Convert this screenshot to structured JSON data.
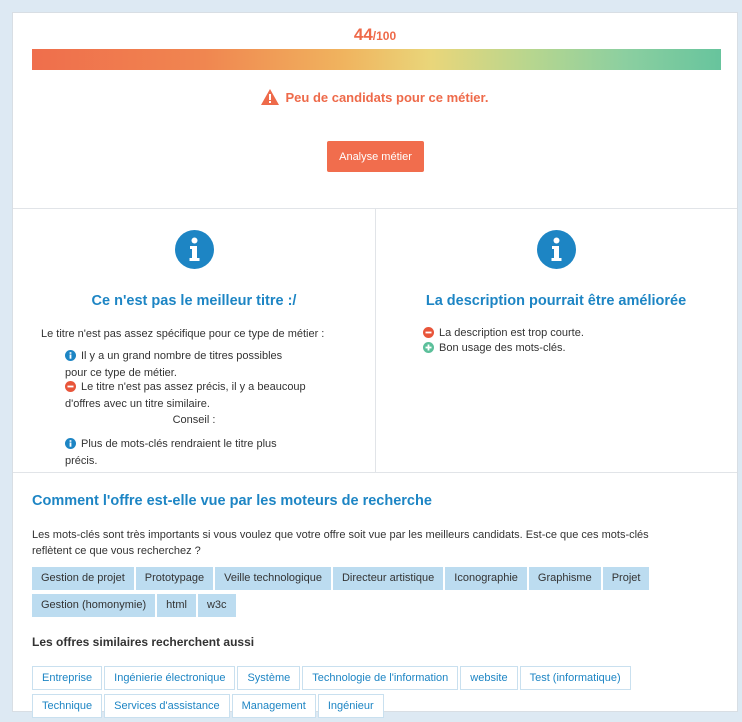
{
  "score": {
    "value": "44",
    "max": "/100",
    "fraction": 0.44
  },
  "warning": {
    "text": "Peu de candidats pour ce métier."
  },
  "analyse_button": "Analyse métier",
  "title_panel": {
    "heading": "Ce n'est pas le meilleur titre :/",
    "intro": "Le titre n'est pas assez spécifique pour ce type de métier :",
    "point1_line1": "Il y a un grand nombre de titres possibles",
    "point1_line2": "pour ce type de métier.",
    "point2_line1": "Le titre n'est pas assez précis, il y a beaucoup",
    "point2_line2": "d'offres avec un titre similaire.",
    "advice_label": "Conseil :",
    "point3_line1": "Plus de mots-clés rendraient le titre plus",
    "point3_line2": "précis."
  },
  "description_panel": {
    "heading": "La description pourrait être améliorée",
    "item1": "La description est trop courte.",
    "item2": "Bon usage des mots-clés."
  },
  "search": {
    "heading": "Comment l'offre est-elle vue par les moteurs de recherche",
    "desc_line1": "Les mots-clés sont très importants si vous voulez que votre offre soit vue par les meilleurs candidats. Est-ce que ces mots-clés",
    "desc_line2": "reflètent ce que vous recherchez ?",
    "keywords_row1": [
      "Gestion de projet",
      "Prototypage",
      "Veille technologique",
      "Directeur artistique",
      "Iconographie",
      "Graphisme",
      "Projet"
    ],
    "keywords_row2": [
      "Gestion (homonymie)",
      "html",
      "w3c"
    ]
  },
  "similar": {
    "heading": "Les offres similaires recherchent aussi",
    "row1": [
      "Entreprise",
      "Ingénierie électronique",
      "Système",
      "Technologie de l'information",
      "website",
      "Test (informatique)"
    ],
    "row2": [
      "Technique",
      "Services d'assistance",
      "Management",
      "Ingénieur"
    ]
  },
  "colors": {
    "accent_orange": "#ee6a4a",
    "accent_blue": "#1d85c4",
    "tag_fill": "#bcdcf0",
    "minus_red": "#e8553a",
    "plus_green": "#5bbf9a"
  },
  "icons": [
    "warning-icon",
    "info-icon",
    "minus-circle-icon",
    "plus-circle-icon"
  ]
}
